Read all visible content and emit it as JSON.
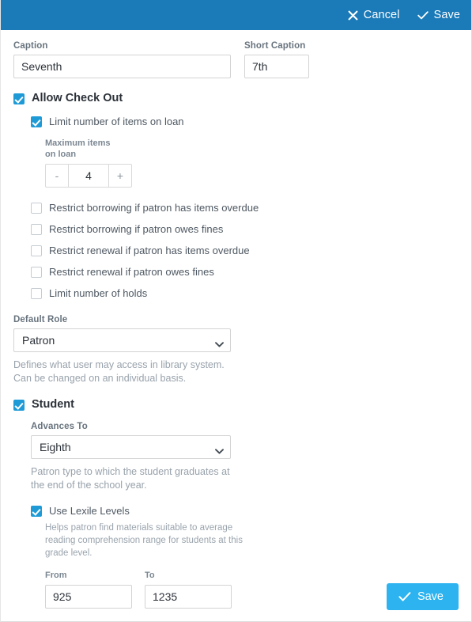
{
  "topbar": {
    "background": "#1b7ab8",
    "cancel_label": "Cancel",
    "cancel_icon": "close-icon",
    "save_label": "Save",
    "save_icon": "check-icon"
  },
  "caption": {
    "label": "Caption",
    "value": "Seventh",
    "placeholder": ""
  },
  "short_caption": {
    "label": "Short Caption",
    "value": "7th",
    "placeholder": ""
  },
  "allow_check_out": {
    "label": "Allow Check Out",
    "checked": true
  },
  "limit_items": {
    "label": "Limit number of items on loan",
    "checked": true
  },
  "max_items": {
    "label": "Maximum items on loan",
    "value": "4",
    "decrement_label": "-",
    "increment_label": "+"
  },
  "restrictions": [
    {
      "label": "Restrict borrowing if patron has items overdue",
      "checked": false
    },
    {
      "label": "Restrict borrowing if patron owes fines",
      "checked": false
    },
    {
      "label": "Restrict renewal if patron has items overdue",
      "checked": false
    },
    {
      "label": "Restrict renewal if patron owes fines",
      "checked": false
    },
    {
      "label": "Limit number of holds",
      "checked": false
    }
  ],
  "default_role": {
    "label": "Default Role",
    "value": "Patron",
    "help": "Defines what user may access in library system. Can be changed on an individual basis.",
    "chevron_icon": "chevron-down-icon"
  },
  "student": {
    "label": "Student",
    "checked": true
  },
  "advances_to": {
    "label": "Advances To",
    "value": "Eighth",
    "help": "Patron type to which the student graduates at the end of the school year.",
    "chevron_icon": "chevron-down-icon"
  },
  "lexile": {
    "label": "Use Lexile Levels",
    "checked": true,
    "help": "Helps patron find materials suitable to average reading comprehension range for students at this grade level.",
    "from_label": "From",
    "from_value": "925",
    "to_label": "To",
    "to_value": "1235"
  },
  "footer": {
    "save_label": "Save",
    "save_icon": "check-icon",
    "save_color": "#2cb3f0"
  }
}
